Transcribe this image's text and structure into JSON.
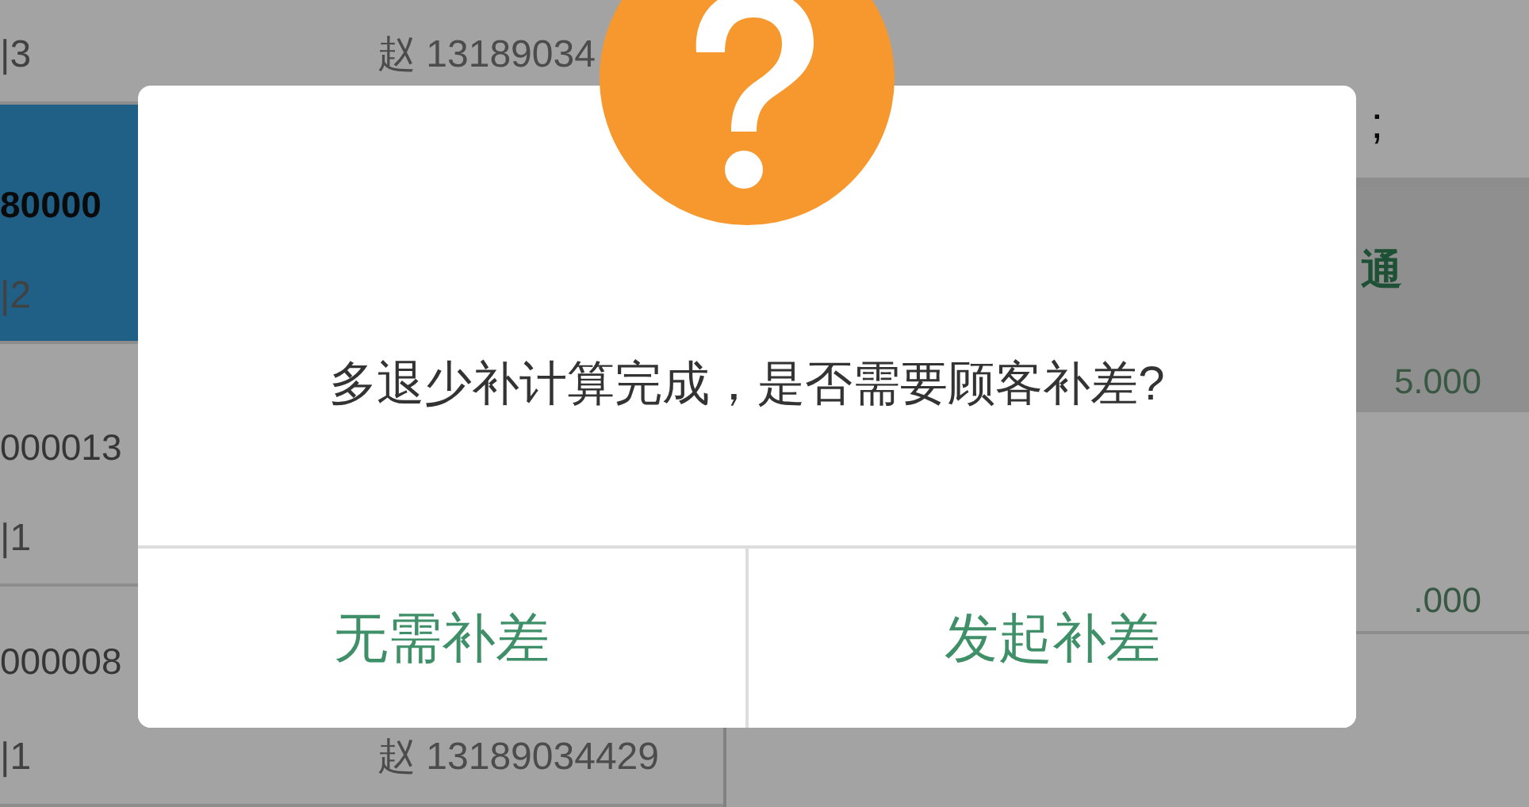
{
  "order_list": {
    "rows": [
      {
        "count": "|3",
        "contact": "赵 13189034",
        "selected": false
      },
      {
        "number": "80000",
        "count": "|2",
        "selected": true
      },
      {
        "number": "000013",
        "count": "|1",
        "selected": false
      },
      {
        "number": "000008",
        "count": "|1",
        "contact": "赵 13189034429",
        "selected": false
      }
    ]
  },
  "detail_panel": {
    "heading": ";",
    "rows": [
      {
        "name": "通",
        "amount": "5.000",
        "selected": true
      },
      {
        "amount": ".000",
        "selected": false
      }
    ]
  },
  "dialog": {
    "kind": "question",
    "message": "多退少补计算完成，是否需要顾客补差?",
    "buttons": [
      {
        "label": "无需补差"
      },
      {
        "label": "发起补差"
      }
    ]
  }
}
